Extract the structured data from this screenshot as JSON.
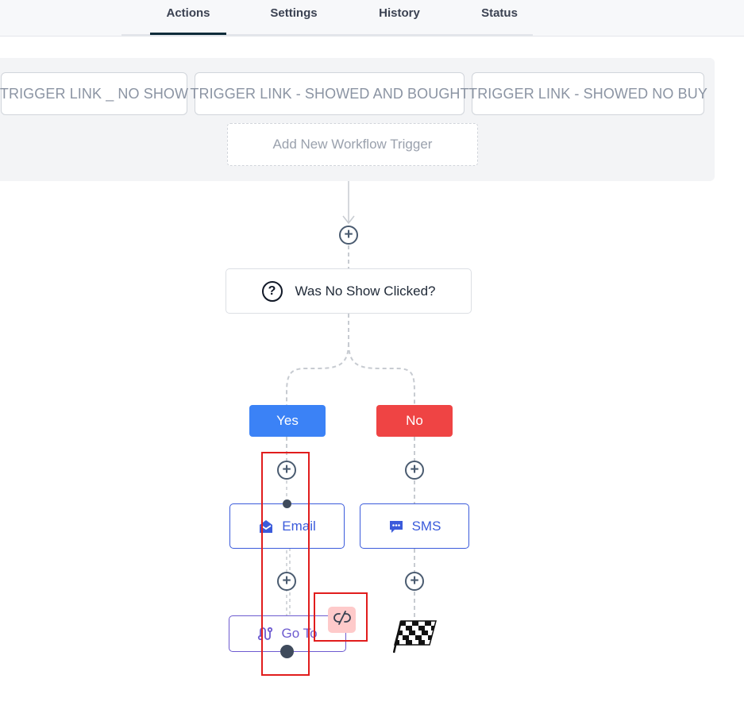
{
  "tabs": [
    {
      "label": "Actions",
      "active": true
    },
    {
      "label": "Settings",
      "active": false
    },
    {
      "label": "History",
      "active": false
    },
    {
      "label": "Status",
      "active": false
    }
  ],
  "triggers": [
    {
      "label": "TRIGGER LINK _ NO SHOW"
    },
    {
      "label": "TRIGGER LINK - SHOWED AND BOUGHT"
    },
    {
      "label": "TRIGGER LINK - SHOWED NO BUY"
    }
  ],
  "add_trigger_label": "Add New Workflow Trigger",
  "condition": {
    "label": "Was No Show Clicked?",
    "icon": "question-circle-icon"
  },
  "branches": {
    "yes": "Yes",
    "no": "No"
  },
  "actions": {
    "email": {
      "label": "Email",
      "icon": "envelope-icon"
    },
    "sms": {
      "label": "SMS",
      "icon": "chat-bubble-icon"
    },
    "goto": {
      "label": "Go To",
      "icon": "route-icon"
    }
  },
  "colors": {
    "yes_branch": "#3b82f6",
    "no_branch": "#ef4444",
    "action_border": "#3b5bdb",
    "goto_border": "#6d5bd0",
    "highlight": "#e11d1d",
    "unlink_bg": "#fecaca"
  }
}
